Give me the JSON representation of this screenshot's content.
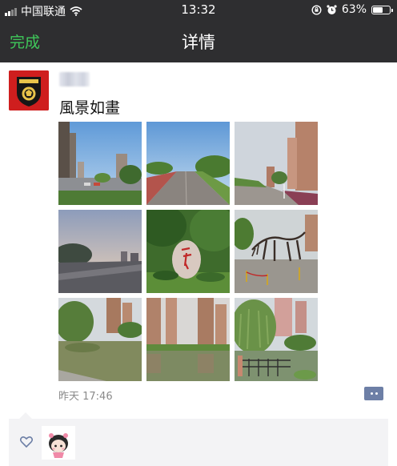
{
  "status_bar": {
    "carrier": "中国联通",
    "time": "13:32",
    "battery_percent": "63%",
    "battery_level": 0.63
  },
  "nav": {
    "done_label": "完成",
    "title": "详情"
  },
  "post": {
    "text": "風景如畫",
    "time": "昨天 17:46",
    "photos": [
      {
        "icon": "road-with-parking-scene"
      },
      {
        "icon": "tree-lined-road-scene"
      },
      {
        "icon": "apartment-road-scene"
      },
      {
        "icon": "dusk-riverside-scene"
      },
      {
        "icon": "red-inscribed-rock-scene"
      },
      {
        "icon": "dinosaur-skeleton-scene"
      },
      {
        "icon": "pond-with-towers-scene"
      },
      {
        "icon": "towers-over-pond-scene"
      },
      {
        "icon": "willow-by-pond-scene"
      }
    ]
  },
  "colors": {
    "bar_bg": "#2e2e30",
    "done_green": "#3fc85a",
    "comment_button": "#6d7fa6",
    "likes_bg": "#f3f3f5"
  }
}
